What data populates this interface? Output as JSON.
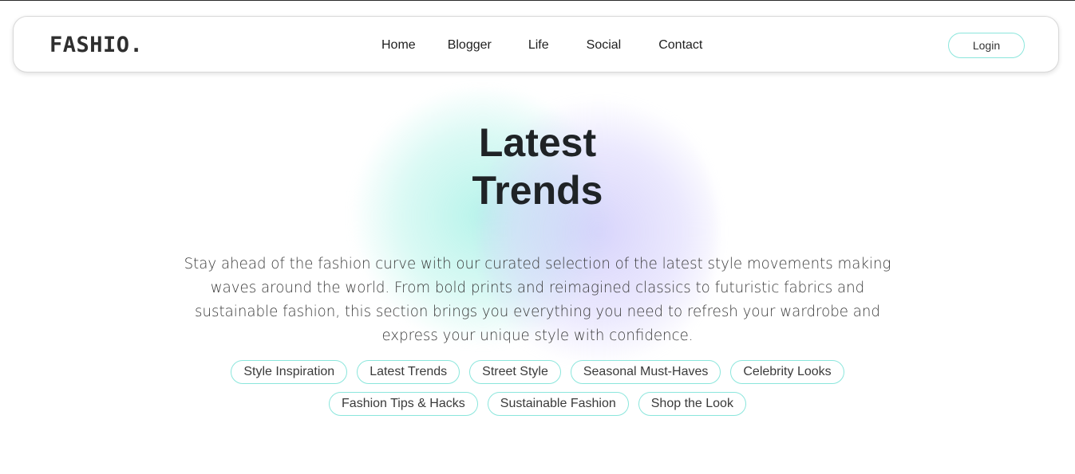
{
  "brand": {
    "logo": "FASHIO."
  },
  "nav": {
    "links": [
      "Home",
      "Blogger",
      "Life",
      "Social",
      "Contact"
    ],
    "login_label": "Login"
  },
  "hero": {
    "title_line1": "Latest",
    "title_line2": "Trends",
    "description": "Stay ahead of the fashion curve with our curated selection of the latest style movements making waves around the world. From bold prints and reimagined classics to futuristic fabrics and sustainable fashion, this section brings you everything you need to refresh your wardrobe and express your unique style with confidence."
  },
  "tags": [
    "Style Inspiration",
    "Latest Trends",
    "Street Style",
    "Seasonal Must-Haves",
    "Celebrity Looks",
    "Fashion Tips & Hacks",
    "Sustainable Fashion",
    "Shop the Look"
  ],
  "colors": {
    "accent_border": "#8be6dc",
    "blob_teal": "#a0f0e4",
    "blob_purple": "#c8c3fa",
    "text_dark": "#1f2326"
  }
}
